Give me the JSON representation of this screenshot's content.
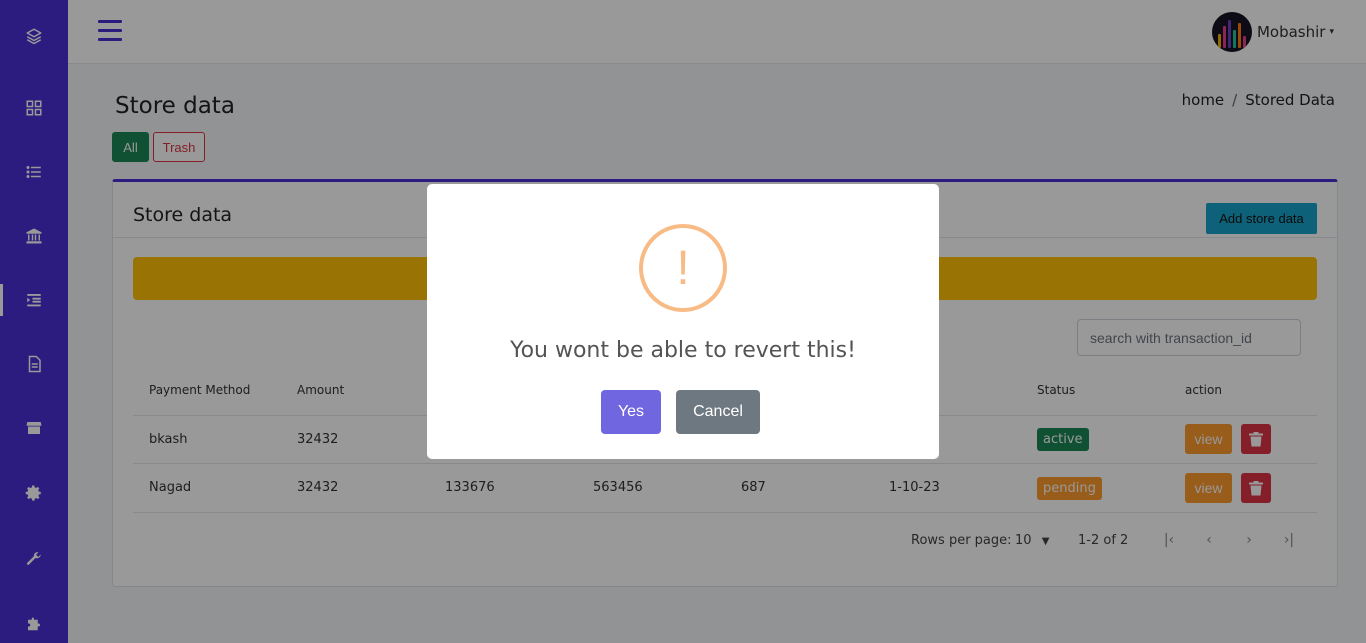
{
  "colors": {
    "sidebar": "#4c2fd6",
    "success": "#198754",
    "danger": "#dc3545",
    "warning": "#ffc107",
    "info": "#17a2c9",
    "orange": "#fd9a2e",
    "confirm": "#7066e0",
    "cancel": "#6e7881",
    "warn_icon": "#f8bb86"
  },
  "sidebar": {
    "icons": [
      "layers-icon",
      "grid-icon",
      "list-icon",
      "bank-icon",
      "indent-list-icon",
      "document-icon",
      "store-icon",
      "gear-icon",
      "wrench-icon",
      "puzzle-icon"
    ],
    "active_index": 4
  },
  "header": {
    "user_name": "Mobashir",
    "caret": "▾"
  },
  "page": {
    "title": "Store data",
    "breadcrumb": {
      "home": "home",
      "sep": "/",
      "current": "Stored Data"
    },
    "filter_all": "All",
    "filter_trash": "Trash"
  },
  "card": {
    "title": "Store data",
    "add_button": "Add store data",
    "search_placeholder": "search with transaction_id"
  },
  "table": {
    "columns": [
      "Payment Method",
      "Amount",
      "",
      "",
      "",
      "",
      "Status",
      "action"
    ],
    "rows": [
      {
        "method": "bkash",
        "amount": "32432",
        "c3": "",
        "c4": "",
        "c5": "",
        "c6": "",
        "status": "active",
        "view": "view"
      },
      {
        "method": "Nagad",
        "amount": "32432",
        "c3": "133676",
        "c4": "563456",
        "c5": "687",
        "c6": "1-10-23",
        "status": "pending",
        "view": "view"
      }
    ],
    "rows_per_page_label": "Rows per page:",
    "rows_per_page": "10",
    "range": "1-2 of 2",
    "pager": {
      "first": "|‹",
      "prev": "‹",
      "next": "›",
      "last": "›|"
    }
  },
  "modal": {
    "icon": "!",
    "title": "You wont be able to revert this!",
    "confirm": "Yes",
    "cancel": "Cancel"
  }
}
